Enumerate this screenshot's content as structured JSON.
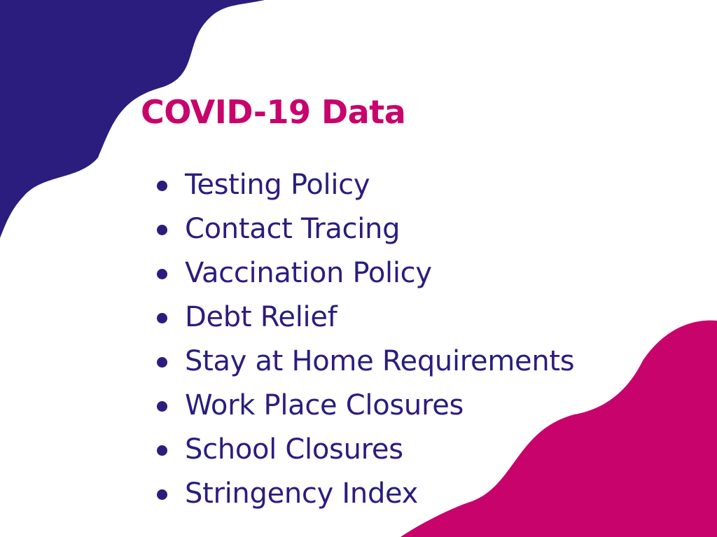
{
  "colors": {
    "background": "#ffffff",
    "navy": "#2a1d7e",
    "magenta": "#c8036c",
    "text": "#2a1d7e"
  },
  "slide": {
    "title": "COVID-19 Data",
    "items": [
      {
        "label": "Testing Policy"
      },
      {
        "label": "Contact Tracing"
      },
      {
        "label": "Vaccination Policy"
      },
      {
        "label": "Debt Relief"
      },
      {
        "label": "Stay at Home Requirements"
      },
      {
        "label": "Work Place Closures"
      },
      {
        "label": "School Closures"
      },
      {
        "label": "Stringency Index"
      }
    ]
  }
}
